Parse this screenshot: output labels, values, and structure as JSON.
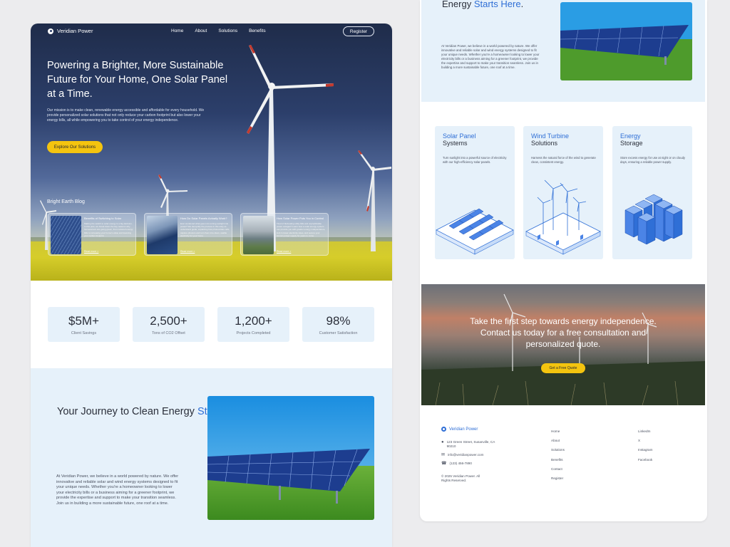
{
  "brand": "Veridian Power",
  "nav": {
    "links": [
      "Home",
      "About",
      "Solutions",
      "Benefits"
    ],
    "register": "Register"
  },
  "hero": {
    "title": "Powering a Brighter, More Sustainable Future for Your Home, One Solar Panel at a Time.",
    "description": "Our mission is to make clean, renewable energy accessible and affordable for every household. We provide personalized solar solutions that not only reduce your carbon footprint but also lower your energy bills, all while empowering you to take control of your energy independence.",
    "cta": "Explore Our Solutions"
  },
  "blog": {
    "title": "Bright Earth Blog",
    "posts": [
      {
        "title": "Benefits of Switching to Solar",
        "excerpt": "Making the switch to solar energy is a big decision. In this post, we break down the key reasons why homeowners are going green, from reduced energy bills to increasing your home's value and lowering your carbon footprint.",
        "link": "Read more >"
      },
      {
        "title": "How Do Solar Panels Actually Work?",
        "excerpt": "Ever wondered what goes into turning sunlight into power? We demystify the process in this easy-to-understand guide, explaining how photovoltaic cells capture photons and turn them into clean, usable electricity for your home.",
        "link": "Read more >"
      },
      {
        "title": "How Solar Power Puts You in Control",
        "excerpt": "Tired of fluctuating utility bills and unpredictable power outages? Learn how a solar energy system can provide you with greater energy independence, lock in lower electricity rates, and secure your home's power supply for years to come.",
        "link": "Read more >"
      }
    ]
  },
  "stats": [
    {
      "value": "$5M+",
      "label": "Client Savings"
    },
    {
      "value": "2,500+",
      "label": "Tons of CO2 Offset"
    },
    {
      "value": "1,200+",
      "label": "Projects Completed"
    },
    {
      "value": "98%",
      "label": "Customer Satisfaction"
    }
  ],
  "journey": {
    "title_part1": "Your Journey to Clean Energy ",
    "title_accent": "Starts Here",
    "title_end": ".",
    "text": "At Veridian Power, we believe in a world powered by nature. We offer innovative and reliable solar and wind energy systems designed to fit your unique needs. Whether you're a homeowner looking to lower your electricity bills or a business aiming for a greener footprint, we provide the expertise and support to make your transition seamless. Join us in building a more sustainable future, one roof at a time."
  },
  "right_journey": {
    "title_part1": "Energy ",
    "title_accent": "Starts Here",
    "title_end": "."
  },
  "services": [
    {
      "title_accent": "Solar Panel",
      "title_rest": "Systems",
      "desc": "Turn sunlight into a powerful source of electricity with our high-efficiency solar panels.",
      "icon": "solar-panel-icon"
    },
    {
      "title_accent": "Wind Turbine",
      "title_rest": "Solutions",
      "desc": "Harness the natural force of the wind to generate clean, consistent energy.",
      "icon": "wind-turbine-icon"
    },
    {
      "title_accent": "Energy",
      "title_rest": "Storage",
      "desc": "Store excess energy for use at night or on cloudy days, ensuring a reliable power supply.",
      "icon": "battery-storage-icon"
    }
  ],
  "cta": {
    "text": "Take the first step towards energy independence. Contact us today for a free consultation and personalized quote.",
    "button": "Get a Free Quote"
  },
  "footer": {
    "address": "123 Green Street, Susanville, CA 90210",
    "email": "info@veridianpower.com",
    "phone": "(123) 456-7890",
    "copyright": "© 2025 Veridian Power. All Rights Reserved.",
    "links": [
      "Home",
      "About",
      "Solutions",
      "Benefits",
      "Contact",
      "Register"
    ],
    "social": [
      "LinkedIn",
      "X",
      "Instagram",
      "Facebook"
    ]
  },
  "colors": {
    "accent": "#2f6fd6",
    "cta_yellow": "#f4c40f",
    "light_blue": "#e6f1fa"
  }
}
